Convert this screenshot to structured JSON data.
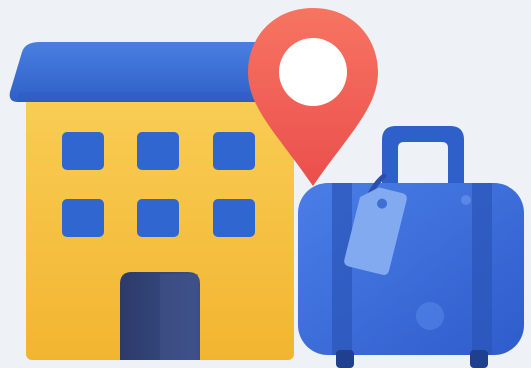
{
  "illustration": {
    "icons": [
      "hotel-building-icon",
      "location-pin-icon",
      "suitcase-icon",
      "luggage-tag-icon"
    ]
  },
  "colors": {
    "background": "#eef1f6",
    "building_wall": "#f7c34a",
    "building_wall_shade": "#f2b632",
    "roof": "#3b6fd6",
    "roof_dark": "#2d5cbf",
    "windows": "#2f67cf",
    "door": "#2e3f72",
    "pin": "#f2645a",
    "pin_hole": "#ffffff",
    "suitcase": "#3a6ad8",
    "suitcase_dark": "#2d55bb",
    "tag": "#7fa8ee"
  }
}
